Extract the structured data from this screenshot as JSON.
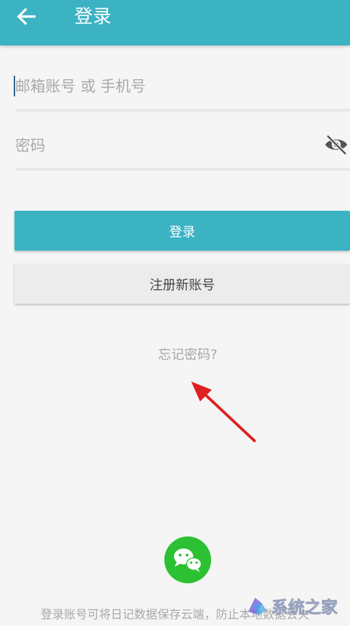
{
  "header": {
    "title": "登录",
    "back_icon": "arrow-left-icon"
  },
  "form": {
    "email_placeholder": "邮箱账号 或 手机号",
    "email_value": "",
    "password_placeholder": "密码",
    "password_value": "",
    "visibility_icon": "eye-off-icon"
  },
  "buttons": {
    "login_label": "登录",
    "register_label": "注册新账号"
  },
  "links": {
    "forgot_password": "忘记密码?"
  },
  "social": {
    "wechat_icon": "wechat-icon"
  },
  "footer": {
    "note": "登录账号可将日记数据保存云端，防止本地数据丢失"
  },
  "watermark": {
    "text": "系统之家"
  },
  "colors": {
    "primary": "#3bb3c3",
    "wechat_green": "#2cc132",
    "annotation_arrow": "#e02020",
    "background": "#f5f5f5"
  }
}
